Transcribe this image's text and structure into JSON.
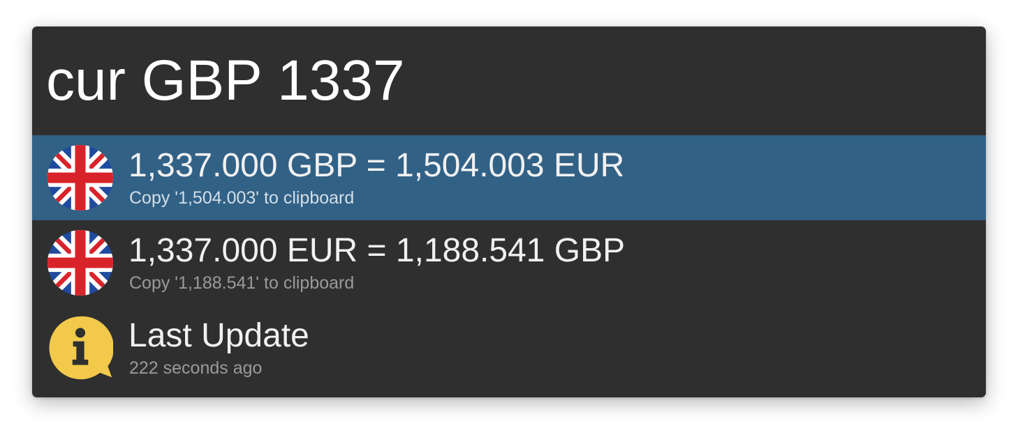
{
  "search": {
    "query": "cur GBP 1337"
  },
  "results": [
    {
      "title": "1,337.000 GBP = 1,504.003 EUR",
      "subtitle": "Copy '1,504.003' to clipboard",
      "icon": "uk-flag-icon",
      "selected": true
    },
    {
      "title": "1,337.000 EUR = 1,188.541 GBP",
      "subtitle": "Copy '1,188.541' to clipboard",
      "icon": "uk-flag-icon",
      "selected": false
    },
    {
      "title": "Last Update",
      "subtitle": "222 seconds ago",
      "icon": "info-icon",
      "selected": false
    }
  ],
  "colors": {
    "window_background": "#2f2f2f",
    "selection": "#326186",
    "info_icon": "#f2c94a"
  }
}
